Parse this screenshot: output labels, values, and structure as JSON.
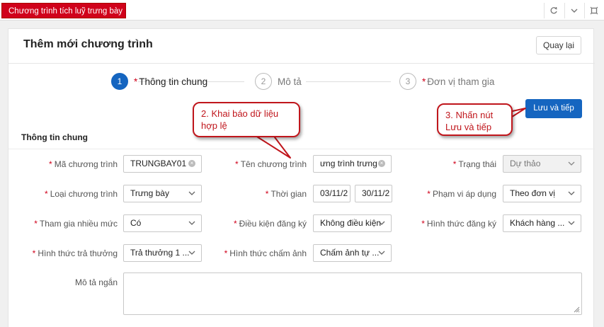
{
  "topbar": {
    "tab_label": "Chương trình tích luỹ trưng bày"
  },
  "page": {
    "title": "Thêm mới chương trình",
    "back_label": "Quay lại"
  },
  "steps": [
    {
      "num": "1",
      "required": "*",
      "label": "Thông tin chung"
    },
    {
      "num": "2",
      "required": "",
      "label": "Mô tả"
    },
    {
      "num": "3",
      "required": "*",
      "label": "Đơn vị tham gia"
    }
  ],
  "save_label": "Lưu và tiếp",
  "section_title": "Thông tin chung",
  "form": {
    "ma_label": "Mã chương trình",
    "ma_value": "TRUNGBAY01",
    "ten_label": "Tên chương trình",
    "ten_value": "ưng trình trưng",
    "trangthai_label": "Trạng thái",
    "trangthai_value": "Dự thảo",
    "loai_label": "Loại chương trình",
    "loai_value": "Trưng bày",
    "thoigian_label": "Thời gian",
    "thoigian_from": "03/11/2",
    "thoigian_to": "30/11/2",
    "phamvi_label": "Phạm vi áp dụng",
    "phamvi_value": "Theo đơn vị",
    "thamgia_label": "Tham gia nhiều mức",
    "thamgia_value": "Có",
    "dieukien_label": "Điều kiện đăng ký",
    "dieukien_value": "Không điều kiện",
    "hinhthucdk_label": "Hình thức đăng ký",
    "hinhthucdk_value": "Khách hàng ...",
    "tra_label": "Hình thức trả thưởng",
    "tra_value": "Trả thưởng 1 ...",
    "cham_label": "Hình thức chấm ảnh",
    "cham_value": "Chấm ảnh tự ...",
    "mota_label": "Mô tả ngắn"
  },
  "callouts": {
    "c2": "2. Khai báo dữ liệu hợp lệ",
    "c3": "3. Nhấn nút Lưu và tiếp"
  },
  "colors": {
    "brand_red": "#d0021b",
    "primary_blue": "#1565c0"
  }
}
